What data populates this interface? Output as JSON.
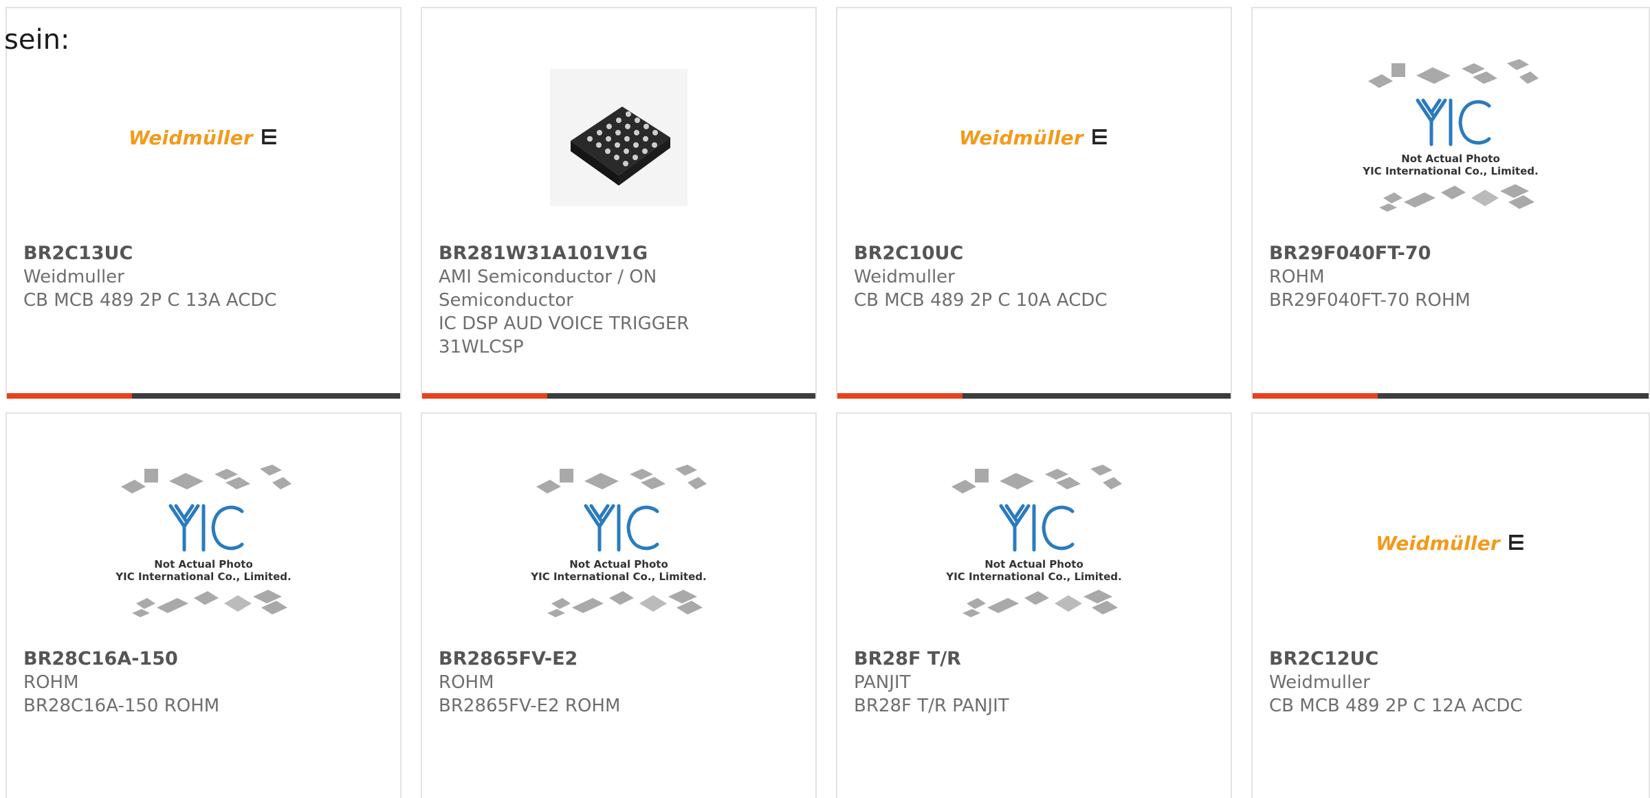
{
  "stray_text": "sein:",
  "products": [
    {
      "part": "BR2C13UC",
      "mfr": "Weidmuller",
      "desc": "CB MCB 489 2P C 13A ACDC",
      "image": "weidmuller-logo"
    },
    {
      "part": "BR281W31A101V1G",
      "mfr": "AMI Semiconductor / ON Semiconductor",
      "desc": "IC DSP AUD VOICE TRIGGER 31WLCSP",
      "image": "bga-chip-photo"
    },
    {
      "part": "BR2C10UC",
      "mfr": "Weidmuller",
      "desc": "CB MCB 489 2P C 10A ACDC",
      "image": "weidmuller-logo"
    },
    {
      "part": "BR29F040FT-70",
      "mfr": "ROHM",
      "desc": "BR29F040FT-70 ROHM",
      "image": "yic-placeholder"
    },
    {
      "part": "BR28C16A-150",
      "mfr": "ROHM",
      "desc": "BR28C16A-150 ROHM",
      "image": "yic-placeholder"
    },
    {
      "part": "BR2865FV-E2",
      "mfr": "ROHM",
      "desc": "BR2865FV-E2 ROHM",
      "image": "yic-placeholder"
    },
    {
      "part": "BR28F T/R",
      "mfr": "PANJIT",
      "desc": "BR28F T/R PANJIT",
      "image": "yic-placeholder"
    },
    {
      "part": "BR2C12UC",
      "mfr": "Weidmuller",
      "desc": "CB MCB 489 2P C 12A ACDC",
      "image": "weidmuller-logo"
    }
  ],
  "logos": {
    "weidmuller_text": "Weidmüller",
    "weidmuller_symbol": "⋿",
    "yic_line1": "Not Actual Photo",
    "yic_line2": "YIC International Co., Limited."
  },
  "colors": {
    "accent": "#e8411e",
    "bar": "#3d3d3d",
    "weidmuller_orange": "#f39a1b",
    "yic_blue": "#2a7bbf"
  }
}
